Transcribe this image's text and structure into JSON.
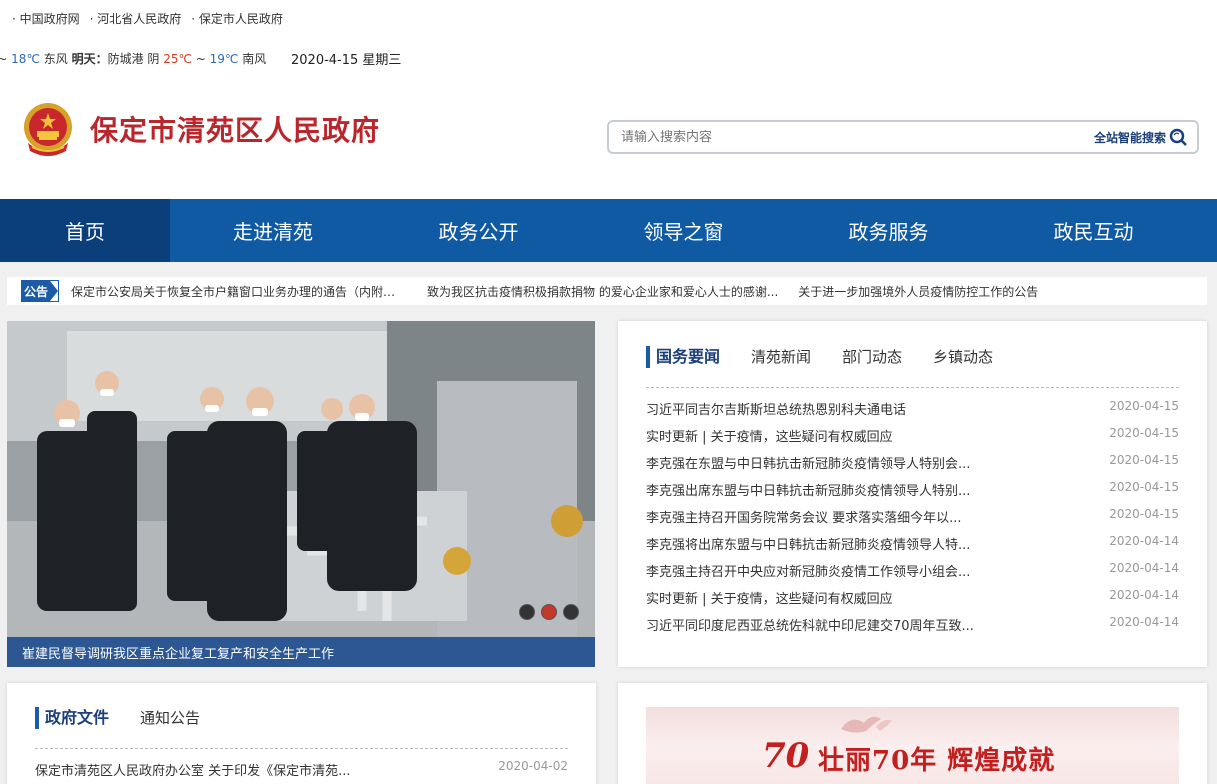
{
  "toplinks": [
    "· 中国政府网",
    "· 河北省人民政府",
    "· 保定市人民政府"
  ],
  "weather": {
    "seg1": "℃ ~ ",
    "temp1": "18℃",
    "seg2": " 东风 ",
    "tomorrow": "明天：",
    "seg3": "防城港 阴 ",
    "hot": "25℃",
    "seg4": " ~ ",
    "cold": "19℃",
    "seg5": " 南风"
  },
  "date": "2020-4-15 星期三",
  "site": {
    "title": "保定市清苑区人民政府"
  },
  "search": {
    "placeholder": "请输入搜索内容",
    "button": "全站智能搜索"
  },
  "nav": [
    "首页",
    "走进清苑",
    "政务公开",
    "领导之窗",
    "政务服务",
    "政民互动"
  ],
  "notice": {
    "badge": "公告",
    "items": [
      "保定市公安局关于恢复全市户籍窗口业务办理的通告（内附清苑...",
      "致为我区抗击疫情积极捐款捐物 的爱心企业家和爱心人士的感谢...",
      "关于进一步加强境外人员疫情防控工作的公告"
    ]
  },
  "slider": {
    "caption": "崔建民督导调研我区重点企业复工复产和安全生产工作"
  },
  "news": {
    "tabs": [
      "国务要闻",
      "清苑新闻",
      "部门动态",
      "乡镇动态"
    ],
    "items": [
      {
        "title": "习近平同吉尔吉斯斯坦总统热恩别科夫通电话",
        "date": "2020-04-15"
      },
      {
        "title": "实时更新 | 关于疫情，这些疑问有权威回应",
        "date": "2020-04-15"
      },
      {
        "title": "李克强在东盟与中日韩抗击新冠肺炎疫情领导人特别会...",
        "date": "2020-04-15"
      },
      {
        "title": "李克强出席东盟与中日韩抗击新冠肺炎疫情领导人特别...",
        "date": "2020-04-15"
      },
      {
        "title": "李克强主持召开国务院常务会议 要求落实落细今年以...",
        "date": "2020-04-15"
      },
      {
        "title": "李克强将出席东盟与中日韩抗击新冠肺炎疫情领导人特...",
        "date": "2020-04-14"
      },
      {
        "title": "李克强主持召开中央应对新冠肺炎疫情工作领导小组会...",
        "date": "2020-04-14"
      },
      {
        "title": "实时更新 | 关于疫情，这些疑问有权威回应",
        "date": "2020-04-14"
      },
      {
        "title": "习近平同印度尼西亚总统佐科就中印尼建交70周年互致...",
        "date": "2020-04-14"
      }
    ]
  },
  "docs": {
    "tabs": [
      "政府文件",
      "通知公告"
    ],
    "items": [
      {
        "title": "保定市清苑区人民政府办公室 关于印发《保定市清苑...",
        "date": "2020-04-02"
      }
    ]
  },
  "banner": {
    "number": "70",
    "text": "壮丽70年  辉煌成就"
  },
  "colors": {
    "brand_red": "#b8272c",
    "nav_blue": "#0f5aa3",
    "nav_active": "#0a3f7c"
  }
}
